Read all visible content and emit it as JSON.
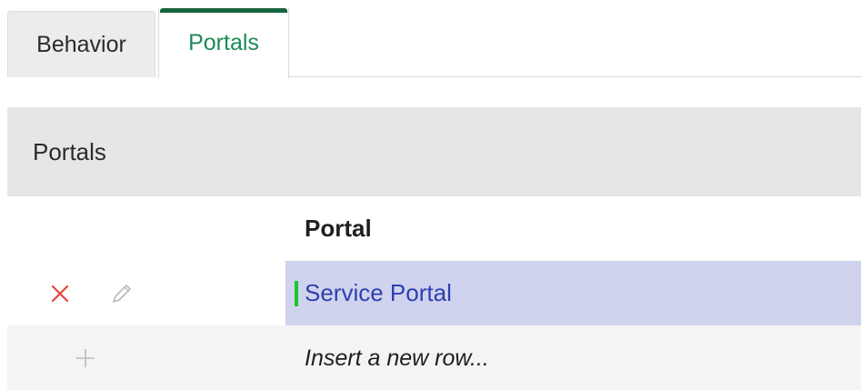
{
  "tabs": [
    {
      "label": "Behavior",
      "active": false
    },
    {
      "label": "Portals",
      "active": true
    }
  ],
  "section": {
    "title": "Portals"
  },
  "table": {
    "column_header": "Portal",
    "rows": [
      {
        "value": "Service Portal"
      }
    ],
    "insert_placeholder": "Insert a new row..."
  },
  "icons": {
    "delete": "close-icon",
    "edit": "pencil-icon",
    "add": "plus-icon"
  },
  "colors": {
    "active_tab_text": "#1b8a56",
    "active_tab_bar": "#17643e",
    "selected_row_bg": "#d0d3ee",
    "link_text": "#2e3fb0",
    "status_indicator": "#1ec42b",
    "delete_icon": "#e4453a"
  }
}
